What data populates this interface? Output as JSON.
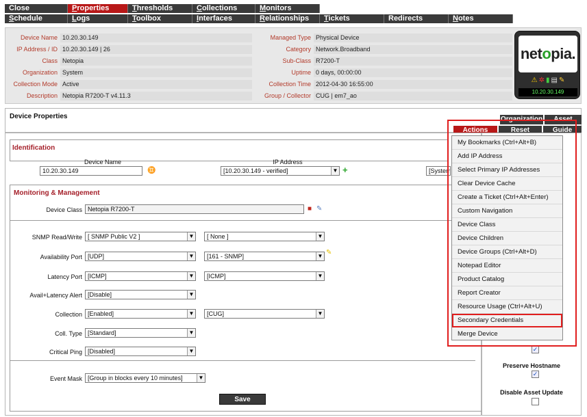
{
  "nav": {
    "row1": [
      "Close",
      "Properties",
      "Thresholds",
      "Collections",
      "Monitors"
    ],
    "row2": [
      "Schedule",
      "Logs",
      "Toolbox",
      "Interfaces",
      "Relationships",
      "Tickets",
      "Redirects",
      "Notes"
    ],
    "active": "Properties"
  },
  "summary": {
    "left": [
      {
        "label": "Device Name",
        "value": "10.20.30.149"
      },
      {
        "label": "IP Address / ID",
        "value": "10.20.30.149 | 26"
      },
      {
        "label": "Class",
        "value": "Netopia"
      },
      {
        "label": "Organization",
        "value": "System"
      },
      {
        "label": "Collection Mode",
        "value": "Active"
      },
      {
        "label": "Description",
        "value": "Netopia R7200-T v4.11.3"
      }
    ],
    "right": [
      {
        "label": "Managed Type",
        "value": "Physical Device"
      },
      {
        "label": "Category",
        "value": "Network.Broadband"
      },
      {
        "label": "Sub-Class",
        "value": "R7200-T"
      },
      {
        "label": "Uptime",
        "value": "0 days, 00:00:00"
      },
      {
        "label": "Collection Time",
        "value": "2012-04-30 16:55:00"
      },
      {
        "label": "Group / Collector",
        "value": "CUG | em7_ao"
      }
    ],
    "logo_text_a": "net",
    "logo_text_b": "o",
    "logo_text_c": "pia.",
    "logo_ip": "10.20.30.149"
  },
  "header": {
    "title": "Device Properties",
    "tabs_top": [
      "Organization",
      "Asset"
    ],
    "tabs_bottom": [
      "Actions",
      "Reset",
      "Guide"
    ]
  },
  "identification": {
    "title": "Identification",
    "device_name_label": "Device Name",
    "device_name_value": "10.20.30.149",
    "ip_label": "IP Address",
    "ip_value": "[10.20.30.149 - verified]",
    "org_value": "[System]"
  },
  "monitoring": {
    "title": "Monitoring & Management",
    "device_class_label": "Device Class",
    "device_class_value": "Netopia R7200-T",
    "fields": [
      {
        "label": "SNMP Read/Write",
        "a": "[ SNMP Public V2 ]",
        "b": "[ None ]"
      },
      {
        "label": "Availability Port",
        "a": "[UDP]",
        "b": "[161 - SNMP]"
      },
      {
        "label": "Latency Port",
        "a": "[ICMP]",
        "b": "[ICMP]"
      },
      {
        "label": "Avail+Latency Alert",
        "a": "[Disable]",
        "b": ""
      },
      {
        "label": "Collection",
        "a": "[Enabled]",
        "b": "[CUG]"
      },
      {
        "label": "Coll. Type",
        "a": "[Standard]",
        "b": ""
      },
      {
        "label": "Critical Ping",
        "a": "[Disabled]",
        "b": ""
      }
    ],
    "event_mask_label": "Event Mask",
    "event_mask_value": "[Group in blocks every 10 minutes]",
    "save_label": "Save"
  },
  "right_panel": {
    "preserve_hostname_label": "Preserve Hostname",
    "preserve_hostname_checked": true,
    "disable_asset_update_label": "Disable Asset Update",
    "disable_asset_update_checked": false
  },
  "actions_menu": {
    "items": [
      "My Bookmarks (Ctrl+Alt+B)",
      "Add IP Address",
      "Select Primary IP Addresses",
      "Clear Device Cache",
      "Create a Ticket (Ctrl+Alt+Enter)",
      "Custom Navigation",
      "Device Class",
      "Device Children",
      "Device Groups (Ctrl+Alt+D)",
      "Notepad Editor",
      "Product Catalog",
      "Report Creator",
      "Resource Usage (Ctrl+Alt+U)",
      "Secondary Credentials",
      "Merge Device"
    ],
    "highlighted": "Secondary Credentials"
  },
  "colors": {
    "accent_red": "#b81818",
    "dark_tab": "#3a3a3a",
    "highlight_outline": "#e01d1d"
  }
}
